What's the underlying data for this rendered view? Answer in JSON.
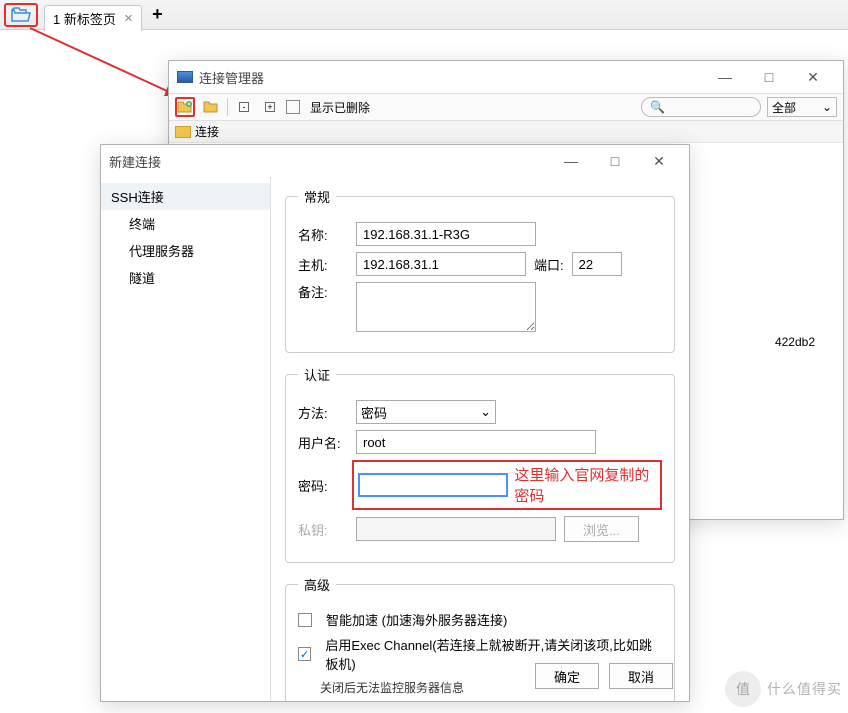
{
  "tabbar": {
    "tab_label": "1 新标签页",
    "plus": "+"
  },
  "mgr": {
    "title": "连接管理器",
    "show_deleted": "显示已删除",
    "search_placeholder": "Q",
    "filter_label": "全部",
    "tree_header": "连接",
    "row_text": "422db2"
  },
  "new_conn": {
    "title": "新建连接",
    "side": {
      "category": "SSH连接",
      "items": [
        "终端",
        "代理服务器",
        "隧道"
      ]
    },
    "general": {
      "legend": "常规",
      "name_label": "名称:",
      "name_value": "192.168.31.1-R3G",
      "host_label": "主机:",
      "host_value": "192.168.31.1",
      "port_label": "端口:",
      "port_value": "22",
      "remark_label": "备注:"
    },
    "auth": {
      "legend": "认证",
      "method_label": "方法:",
      "method_value": "密码",
      "user_label": "用户名:",
      "user_value": "root",
      "pwd_label": "密码:",
      "key_label": "私钥:",
      "browse": "浏览...",
      "annotation": "这里输入官网复制的密码"
    },
    "advanced": {
      "legend": "高级",
      "smart_boost": "智能加速 (加速海外服务器连接)",
      "exec_channel": "启用Exec Channel(若连接上就被断开,请关闭该项,比如跳板机)",
      "exec_note": "关闭后无法监控服务器信息"
    },
    "ok": "确定",
    "cancel": "取消"
  },
  "watermark": {
    "logo": "值",
    "text": "什么值得买"
  }
}
